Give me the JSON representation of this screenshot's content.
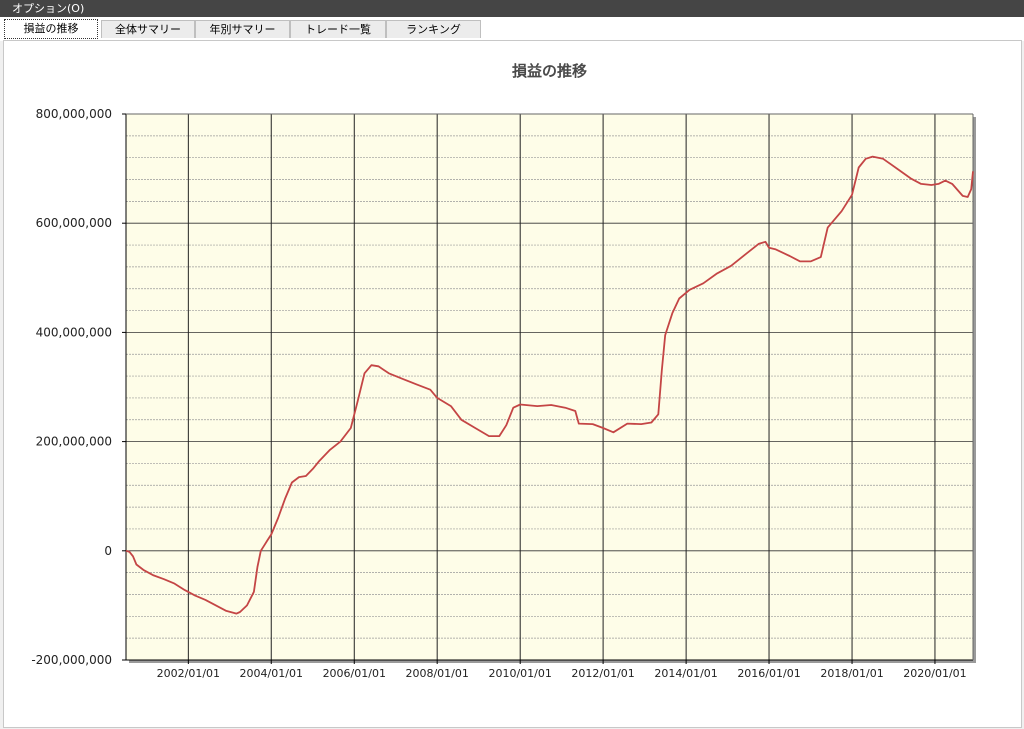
{
  "menubar": {
    "options_label": "オプション(O)"
  },
  "tabs": [
    {
      "label": "損益の推移",
      "active": true
    },
    {
      "label": "全体サマリー",
      "active": false
    },
    {
      "label": "年別サマリー",
      "active": false
    },
    {
      "label": "トレード一覧",
      "active": false
    },
    {
      "label": "ランキング",
      "active": false
    }
  ],
  "colors": {
    "plot_bg": "#fefde8",
    "line": "#c44545",
    "grid_major": "#333333",
    "grid_minor": "#999999"
  },
  "chart_data": {
    "type": "line",
    "title": "損益の推移",
    "ylim": [
      -200000000,
      800000000
    ],
    "yticks": [
      {
        "value": 800000000,
        "label": "800,000,000"
      },
      {
        "value": 600000000,
        "label": "600,000,000"
      },
      {
        "value": 400000000,
        "label": "400,000,000"
      },
      {
        "value": 200000000,
        "label": "200,000,000"
      },
      {
        "value": 0,
        "label": "0"
      },
      {
        "value": -200000000,
        "label": "-200,000,000"
      }
    ],
    "xlim": [
      "2000/07/01",
      "2020/12/01"
    ],
    "xticks": [
      "2002/01/01",
      "2004/01/01",
      "2006/01/01",
      "2008/01/01",
      "2010/01/01",
      "2012/01/01",
      "2014/01/01",
      "2016/01/01",
      "2018/01/01",
      "2020/01/01"
    ],
    "grid": true,
    "series": [
      {
        "x": [
          "2000/07/01",
          "2000/08/01",
          "2000/09/01",
          "2000/10/01",
          "2000/12/01",
          "2001/03/01",
          "2001/06/01",
          "2001/09/01",
          "2001/12/01",
          "2002/03/01",
          "2002/06/01",
          "2002/09/01",
          "2002/12/01",
          "2003/03/01",
          "2003/04/01",
          "2003/06/01",
          "2003/08/01",
          "2003/09/01",
          "2003/10/01",
          "2003/11/01",
          "2003/12/01",
          "2004/01/01",
          "2004/03/01",
          "2004/05/01",
          "2004/07/01",
          "2004/09/01",
          "2004/11/01",
          "2005/01/01",
          "2005/03/01",
          "2005/06/01",
          "2005/09/01",
          "2005/12/01",
          "2006/01/01",
          "2006/02/01",
          "2006/04/01",
          "2006/06/01",
          "2006/08/01",
          "2006/11/01",
          "2007/03/01",
          "2007/07/01",
          "2007/11/01",
          "2008/01/01",
          "2008/05/01",
          "2008/08/01",
          "2008/12/01",
          "2009/04/01",
          "2009/07/01",
          "2009/09/01",
          "2009/11/01",
          "2010/01/01",
          "2010/06/01",
          "2010/10/01",
          "2011/02/01",
          "2011/05/01",
          "2011/06/01",
          "2011/10/01",
          "2012/01/01",
          "2012/04/01",
          "2012/08/01",
          "2012/12/01",
          "2013/03/01",
          "2013/05/01",
          "2013/06/01",
          "2013/07/01",
          "2013/09/01",
          "2013/11/01",
          "2014/02/01",
          "2014/06/01",
          "2014/10/01",
          "2015/02/01",
          "2015/06/01",
          "2015/10/01",
          "2015/12/01",
          "2016/01/01",
          "2016/03/01",
          "2016/07/01",
          "2016/10/01",
          "2017/01/01",
          "2017/04/01",
          "2017/06/01",
          "2017/10/01",
          "2018/01/01",
          "2018/03/01",
          "2018/05/01",
          "2018/07/01",
          "2018/10/01",
          "2019/02/01",
          "2019/06/01",
          "2019/09/01",
          "2019/12/01",
          "2020/02/01",
          "2020/04/01",
          "2020/06/01",
          "2020/09/01",
          "2020/10/15",
          "2020/11/15",
          "2020/12/01"
        ],
        "values": [
          0,
          -2000000,
          -10000000,
          -25000000,
          -35000000,
          -45000000,
          -52000000,
          -60000000,
          -72000000,
          -82000000,
          -90000000,
          -100000000,
          -110000000,
          -115000000,
          -112000000,
          -100000000,
          -75000000,
          -30000000,
          0,
          10000000,
          20000000,
          30000000,
          60000000,
          95000000,
          125000000,
          135000000,
          137000000,
          150000000,
          165000000,
          185000000,
          200000000,
          225000000,
          250000000,
          275000000,
          325000000,
          340000000,
          338000000,
          325000000,
          315000000,
          305000000,
          295000000,
          280000000,
          265000000,
          240000000,
          225000000,
          210000000,
          210000000,
          230000000,
          262000000,
          268000000,
          265000000,
          267000000,
          262000000,
          256000000,
          233000000,
          232000000,
          225000000,
          217000000,
          233000000,
          232000000,
          235000000,
          250000000,
          330000000,
          395000000,
          435000000,
          462000000,
          478000000,
          490000000,
          508000000,
          522000000,
          542000000,
          562000000,
          566000000,
          555000000,
          552000000,
          540000000,
          530000000,
          530000000,
          538000000,
          592000000,
          622000000,
          652000000,
          702000000,
          718000000,
          722000000,
          718000000,
          700000000,
          682000000,
          672000000,
          670000000,
          672000000,
          678000000,
          672000000,
          650000000,
          648000000,
          662000000,
          695000000
        ]
      }
    ]
  }
}
